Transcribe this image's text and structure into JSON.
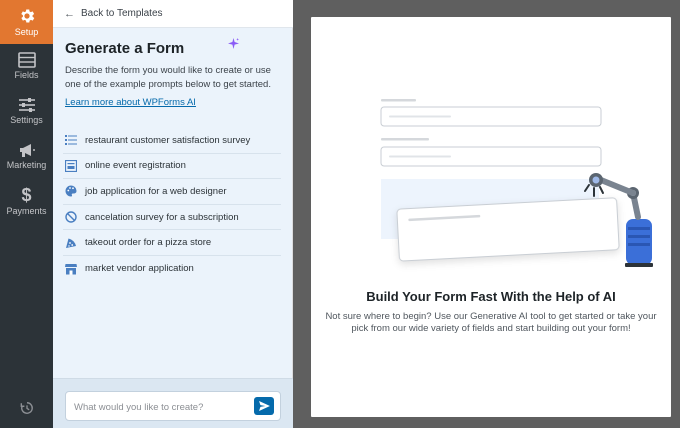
{
  "rail": {
    "items": [
      {
        "label": "Setup",
        "icon": "gear-icon",
        "active": true
      },
      {
        "label": "Fields",
        "icon": "fields-icon",
        "active": false
      },
      {
        "label": "Settings",
        "icon": "sliders-icon",
        "active": false
      },
      {
        "label": "Marketing",
        "icon": "megaphone-icon",
        "active": false
      },
      {
        "label": "Payments",
        "icon": "dollar-icon",
        "active": false
      }
    ],
    "bottom_icon": "history-icon"
  },
  "panel": {
    "back_label": "Back to Templates",
    "title": "Generate a Form",
    "description": "Describe the form you would like to create or use one of the example prompts below to get started.",
    "learn_link": "Learn more about WPForms AI",
    "prompts": [
      {
        "label": "restaurant customer satisfaction survey",
        "icon": "survey-icon"
      },
      {
        "label": "online event registration",
        "icon": "registration-icon"
      },
      {
        "label": "job application for a web designer",
        "icon": "palette-icon"
      },
      {
        "label": "cancelation survey for a subscription",
        "icon": "cancel-icon"
      },
      {
        "label": "takeout order for a pizza store",
        "icon": "pizza-icon"
      },
      {
        "label": "market vendor application",
        "icon": "store-icon"
      }
    ],
    "chat_placeholder": "What would you like to create?"
  },
  "canvas": {
    "title": "Build Your Form Fast With the Help of AI",
    "subtitle": "Not sure where to begin? Use our Generative AI tool to get started or take your pick from our wide variety of fields and start building out your form!"
  },
  "colors": {
    "accent_orange": "#e27730",
    "rail_bg": "#2c3338",
    "panel_bg": "#ebf3fb",
    "link_blue": "#056aab",
    "robot_blue": "#3b6fd8"
  }
}
